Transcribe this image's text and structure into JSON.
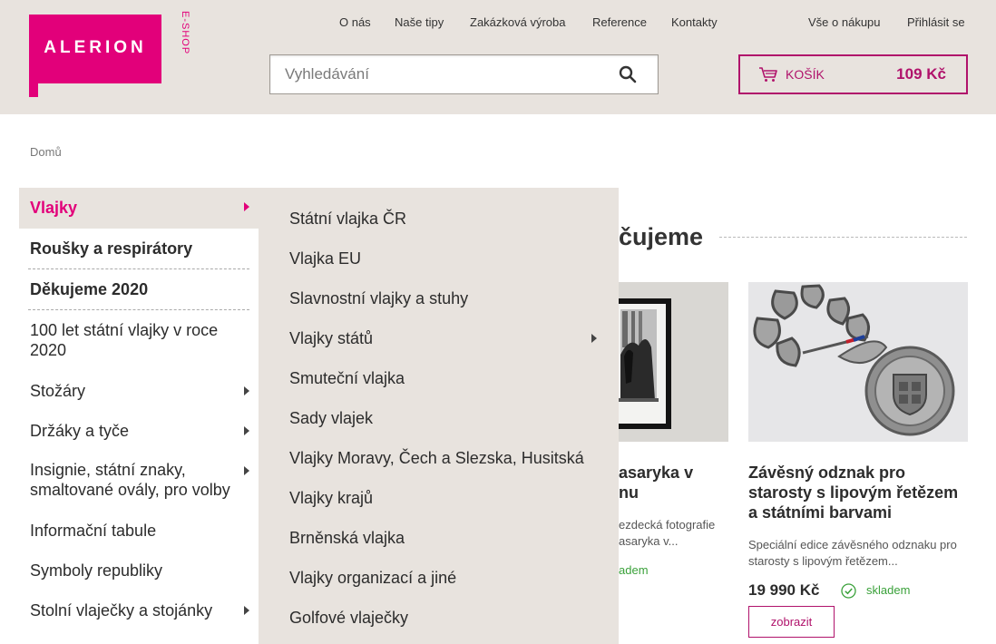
{
  "header": {
    "logo_text": "ALERION",
    "eshop_label": "E-SHOP",
    "nav": [
      "O nás",
      "Naše tipy",
      "Zakázková výroba",
      "Reference",
      "Kontakty"
    ],
    "nav_right": [
      "Vše o nákupu",
      "Přihlásit se"
    ],
    "search_placeholder": "Vyhledávání",
    "cart_label": "KOŠÍK",
    "cart_total": "109 Kč",
    "brand_color": "#e2007a"
  },
  "breadcrumb": "Domů",
  "left_menu": [
    {
      "label": "Vlajky",
      "has_sub": true,
      "state": "active"
    },
    {
      "label": "Roušky a respirátory",
      "has_sub": false,
      "state": "bold"
    },
    {
      "label": "Děkujeme 2020",
      "has_sub": false,
      "state": "bold"
    },
    {
      "label": "100 let státní vlajky v roce 2020",
      "has_sub": false
    },
    {
      "label": "Stožáry",
      "has_sub": true
    },
    {
      "label": "Držáky a tyče",
      "has_sub": true
    },
    {
      "label": "Insignie, státní znaky, smaltované ovály, pro volby",
      "has_sub": true
    },
    {
      "label": "Informační tabule",
      "has_sub": false
    },
    {
      "label": "Symboly republiky",
      "has_sub": false
    },
    {
      "label": "Stolní vlaječky a stojánky",
      "has_sub": true
    }
  ],
  "submenu": [
    {
      "label": "Státní vlajka ČR"
    },
    {
      "label": "Vlajka EU"
    },
    {
      "label": "Slavnostní vlajky a stuhy"
    },
    {
      "label": "Vlajky států",
      "has_sub": true
    },
    {
      "label": "Smuteční vlajka"
    },
    {
      "label": "Sady vlajek"
    },
    {
      "label": "Vlajky Moravy, Čech a Slezska, Husitská"
    },
    {
      "label": "Vlajky krajů"
    },
    {
      "label": "Brněnská vlajka"
    },
    {
      "label": "Vlajky organizací a jiné"
    },
    {
      "label": "Golfové vlaječky"
    }
  ],
  "main": {
    "section_title": "čujeme",
    "products": [
      {
        "title_line1": "asaryka v",
        "title_line2": "nu",
        "desc_line1": "ezdecká fotografie",
        "desc_line2": "asaryka v...",
        "stock": "adem"
      },
      {
        "title_line1": "Závěsný odznak pro",
        "title_line2": "starosty s lipovým řetězem",
        "title_line3": "a státními barvami",
        "desc_line1": "Speciální edice závěsného odznaku pro",
        "desc_line2": "starosty s lipovým řetězem...",
        "price": "19 990 Kč",
        "stock": "skladem",
        "button": "zobrazit"
      }
    ]
  }
}
